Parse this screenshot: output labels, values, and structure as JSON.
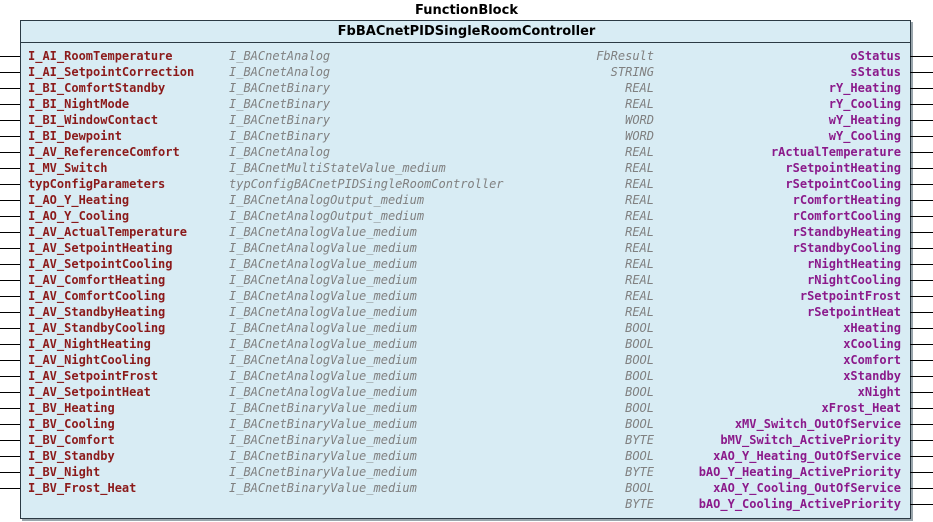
{
  "header": {
    "title": "FunctionBlock",
    "block_name": "FbBACnetPIDSingleRoomController"
  },
  "inputs": [
    {
      "name": "I_AI_RoomTemperature",
      "type": "I_BACnetAnalog"
    },
    {
      "name": "I_AI_SetpointCorrection",
      "type": "I_BACnetAnalog"
    },
    {
      "name": "I_BI_ComfortStandby",
      "type": "I_BACnetBinary"
    },
    {
      "name": "I_BI_NightMode",
      "type": "I_BACnetBinary"
    },
    {
      "name": "I_BI_WindowContact",
      "type": "I_BACnetBinary"
    },
    {
      "name": "I_BI_Dewpoint",
      "type": "I_BACnetBinary"
    },
    {
      "name": "I_AV_ReferenceComfort",
      "type": "I_BACnetAnalog"
    },
    {
      "name": "I_MV_Switch",
      "type": "I_BACnetMultiStateValue_medium"
    },
    {
      "name": "typConfigParameters",
      "type": "typConfigBACnetPIDSingleRoomController"
    },
    {
      "name": "I_AO_Y_Heating",
      "type": "I_BACnetAnalogOutput_medium"
    },
    {
      "name": "I_AO_Y_Cooling",
      "type": "I_BACnetAnalogOutput_medium"
    },
    {
      "name": "I_AV_ActualTemperature",
      "type": "I_BACnetAnalogValue_medium"
    },
    {
      "name": "I_AV_SetpointHeating",
      "type": "I_BACnetAnalogValue_medium"
    },
    {
      "name": "I_AV_SetpointCooling",
      "type": "I_BACnetAnalogValue_medium"
    },
    {
      "name": "I_AV_ComfortHeating",
      "type": "I_BACnetAnalogValue_medium"
    },
    {
      "name": "I_AV_ComfortCooling",
      "type": "I_BACnetAnalogValue_medium"
    },
    {
      "name": "I_AV_StandbyHeating",
      "type": "I_BACnetAnalogValue_medium"
    },
    {
      "name": "I_AV_StandbyCooling",
      "type": "I_BACnetAnalogValue_medium"
    },
    {
      "name": "I_AV_NightHeating",
      "type": "I_BACnetAnalogValue_medium"
    },
    {
      "name": "I_AV_NightCooling",
      "type": "I_BACnetAnalogValue_medium"
    },
    {
      "name": "I_AV_SetpointFrost",
      "type": "I_BACnetAnalogValue_medium"
    },
    {
      "name": "I_AV_SetpointHeat",
      "type": "I_BACnetAnalogValue_medium"
    },
    {
      "name": "I_BV_Heating",
      "type": "I_BACnetBinaryValue_medium"
    },
    {
      "name": "I_BV_Cooling",
      "type": "I_BACnetBinaryValue_medium"
    },
    {
      "name": "I_BV_Comfort",
      "type": "I_BACnetBinaryValue_medium"
    },
    {
      "name": "I_BV_Standby",
      "type": "I_BACnetBinaryValue_medium"
    },
    {
      "name": "I_BV_Night",
      "type": "I_BACnetBinaryValue_medium"
    },
    {
      "name": "I_BV_Frost_Heat",
      "type": "I_BACnetBinaryValue_medium"
    }
  ],
  "outputs": [
    {
      "type": "FbResult",
      "name": "oStatus"
    },
    {
      "type": "STRING",
      "name": "sStatus"
    },
    {
      "type": "REAL",
      "name": "rY_Heating"
    },
    {
      "type": "REAL",
      "name": "rY_Cooling"
    },
    {
      "type": "WORD",
      "name": "wY_Heating"
    },
    {
      "type": "WORD",
      "name": "wY_Cooling"
    },
    {
      "type": "REAL",
      "name": "rActualTemperature"
    },
    {
      "type": "REAL",
      "name": "rSetpointHeating"
    },
    {
      "type": "REAL",
      "name": "rSetpointCooling"
    },
    {
      "type": "REAL",
      "name": "rComfortHeating"
    },
    {
      "type": "REAL",
      "name": "rComfortCooling"
    },
    {
      "type": "REAL",
      "name": "rStandbyHeating"
    },
    {
      "type": "REAL",
      "name": "rStandbyCooling"
    },
    {
      "type": "REAL",
      "name": "rNightHeating"
    },
    {
      "type": "REAL",
      "name": "rNightCooling"
    },
    {
      "type": "REAL",
      "name": "rSetpointFrost"
    },
    {
      "type": "REAL",
      "name": "rSetpointHeat"
    },
    {
      "type": "BOOL",
      "name": "xHeating"
    },
    {
      "type": "BOOL",
      "name": "xCooling"
    },
    {
      "type": "BOOL",
      "name": "xComfort"
    },
    {
      "type": "BOOL",
      "name": "xStandby"
    },
    {
      "type": "BOOL",
      "name": "xNight"
    },
    {
      "type": "BOOL",
      "name": "xFrost_Heat"
    },
    {
      "type": "BOOL",
      "name": "xMV_Switch_OutOfService"
    },
    {
      "type": "BYTE",
      "name": "bMV_Switch_ActivePriority"
    },
    {
      "type": "BOOL",
      "name": "xAO_Y_Heating_OutOfService"
    },
    {
      "type": "BYTE",
      "name": "bAO_Y_Heating_ActivePriority"
    },
    {
      "type": "BOOL",
      "name": "xAO_Y_Cooling_OutOfService"
    },
    {
      "type": "BYTE",
      "name": "bAO_Y_Cooling_ActivePriority"
    }
  ],
  "colors": {
    "block_fill": "#d8ecf4",
    "input_name": "#8b1a1a",
    "output_name": "#8b1a8b",
    "type_text": "#808080"
  }
}
